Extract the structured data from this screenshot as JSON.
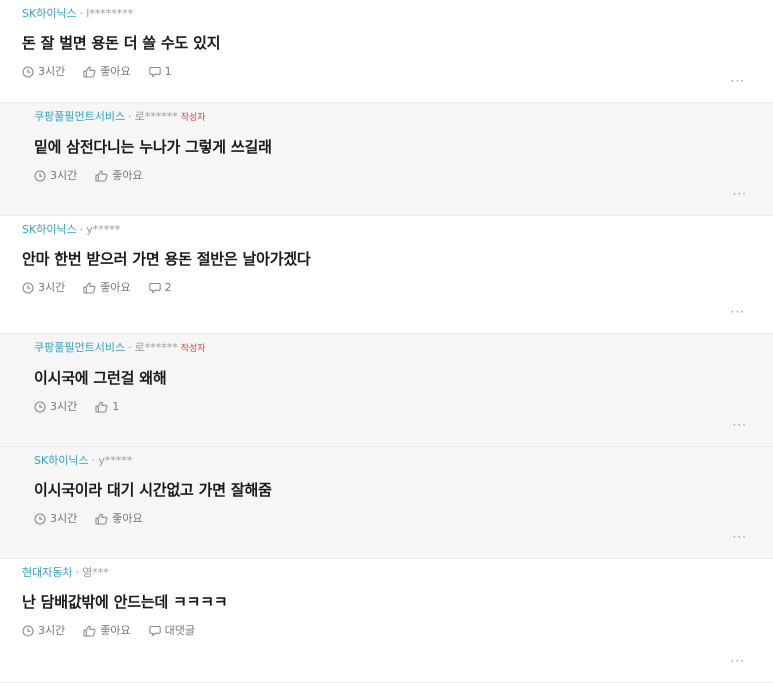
{
  "comments": [
    {
      "company": "SK하이닉스",
      "author": "l********",
      "badge": "",
      "text": "돈 잘 벌면 용돈 더 쓸 수도 있지",
      "time": "3시간",
      "like": "좋아요",
      "reply": "1",
      "is_reply": false
    },
    {
      "company": "쿠팡풀필먼트서비스",
      "author": "로******",
      "badge": "작성자",
      "text": "밑에 삼전다니는 누나가 그렇게 쓰길래",
      "time": "3시간",
      "like": "좋아요",
      "reply": "",
      "is_reply": true
    },
    {
      "company": "SK하이닉스",
      "author": "y*****",
      "badge": "",
      "text": "안마 한번 받으러 가면 용돈 절반은 날아가겠다",
      "time": "3시간",
      "like": "좋아요",
      "reply": "2",
      "is_reply": false
    },
    {
      "company": "쿠팡풀필먼트서비스",
      "author": "로******",
      "badge": "작성자",
      "text": "이시국에 그런걸 왜해",
      "time": "3시간",
      "like": "1",
      "reply": "",
      "is_reply": true
    },
    {
      "company": "SK하이닉스",
      "author": "y*****",
      "badge": "",
      "text": "이시국이라 대기 시간없고 가면 잘해줌",
      "time": "3시간",
      "like": "좋아요",
      "reply": "",
      "is_reply": true
    },
    {
      "company": "현대자동차",
      "author": "영***",
      "badge": "",
      "text": "난 담배값밖에 안드는데 ㅋㅋㅋㅋ",
      "time": "3시간",
      "like": "좋아요",
      "reply": "대댓글",
      "is_reply": false
    }
  ],
  "ui": {
    "separator": "·",
    "more": "···"
  },
  "icons": {
    "time": "clock-icon",
    "like": "thumbs-up-icon",
    "reply": "speech-bubble-icon"
  },
  "colors": {
    "company": "#2ea3c5",
    "badge": "#e0413d",
    "reply_background": "#f6f6f6"
  }
}
